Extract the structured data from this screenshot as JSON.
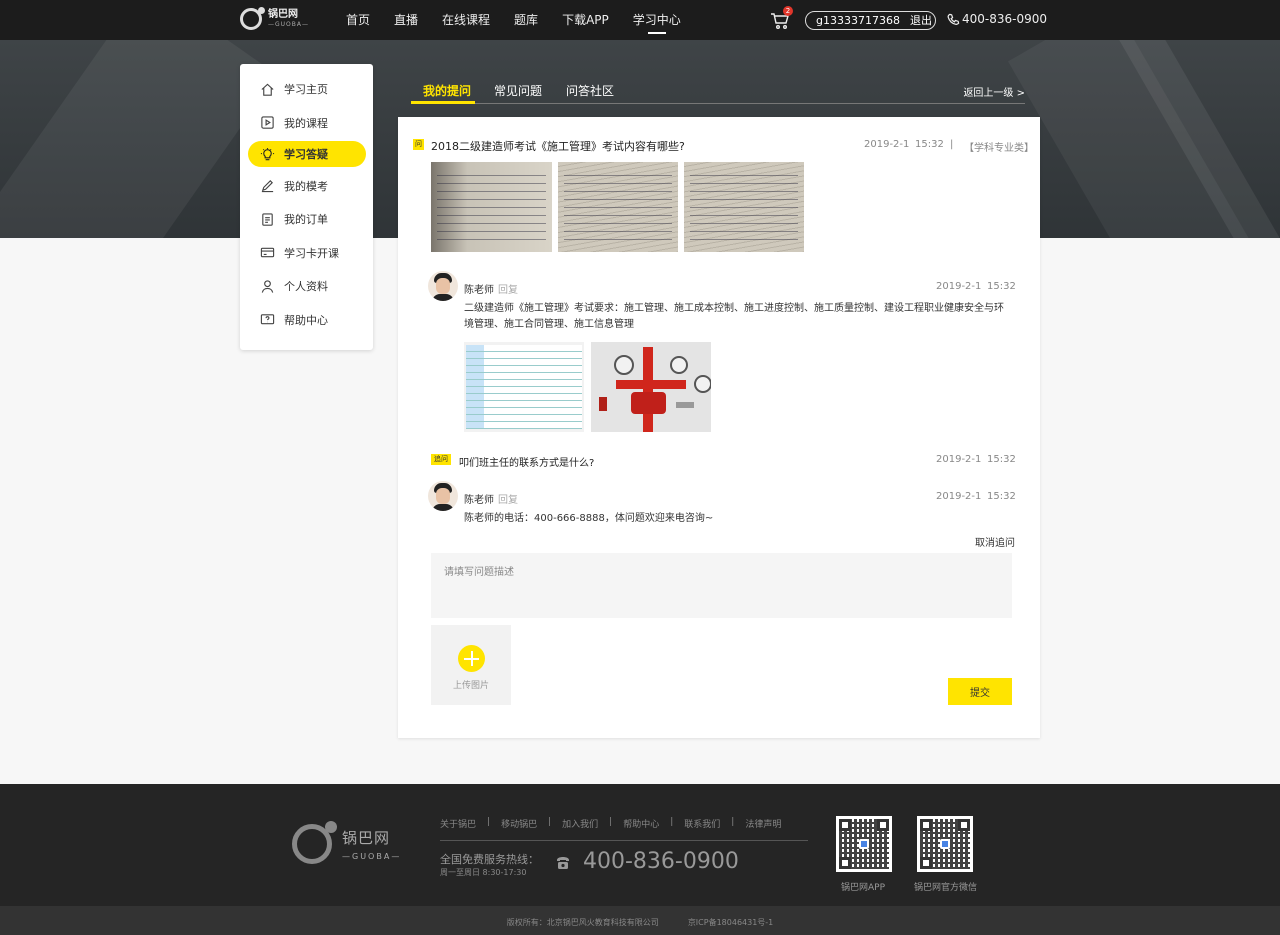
{
  "header": {
    "logo_cn": "锅巴网",
    "logo_en": "—GUOBA—",
    "nav": [
      "首页",
      "直播",
      "在线课程",
      "题库",
      "下载APP",
      "学习中心"
    ],
    "cart_count": "2",
    "username": "g13333717368",
    "logout": "退出",
    "hotline": "400-836-0900"
  },
  "sidebar": {
    "items": [
      {
        "label": "学习主页",
        "icon": "home-icon"
      },
      {
        "label": "我的课程",
        "icon": "play-icon"
      },
      {
        "label": "学习答疑",
        "icon": "lightbulb-icon"
      },
      {
        "label": "我的模考",
        "icon": "pen-icon"
      },
      {
        "label": "我的订单",
        "icon": "order-icon"
      },
      {
        "label": "学习卡开课",
        "icon": "card-icon"
      },
      {
        "label": "个人资料",
        "icon": "user-icon"
      },
      {
        "label": "帮助中心",
        "icon": "help-icon"
      }
    ]
  },
  "tabs": {
    "items": [
      "我的提问",
      "常见问题",
      "问答社区"
    ],
    "back": "返回上一级 >"
  },
  "question": {
    "badge": "问",
    "title": "2018二级建造师考试《施工管理》考试内容有哪些?",
    "date": "2019-2-1",
    "time": "15:32",
    "separator": "|",
    "category": "【学科专业类】"
  },
  "answer1": {
    "teacher": "陈老师",
    "reply_label": "回复",
    "date": "2019-2-1",
    "time": "15:32",
    "text": "二级建造师《施工管理》考试要求：施工管理、施工成本控制、施工进度控制、施工质量控制、建设工程职业健康安全与环境管理、施工合同管理、施工信息管理"
  },
  "followup": {
    "badge": "追问",
    "title": "叩们班主任的联系方式是什么?",
    "date": "2019-2-1",
    "time": "15:32"
  },
  "answer2": {
    "teacher": "陈老师",
    "reply_label": "回复",
    "date": "2019-2-1",
    "time": "15:32",
    "text": "陈老师的电话：400-666-8888，体问题欢迎来电咨询~"
  },
  "form": {
    "cancel": "取消追问",
    "placeholder": "请填写问题描述",
    "upload_label": "上传图片",
    "submit": "提交"
  },
  "footer": {
    "logo_cn": "锅巴网",
    "logo_en": "—GUOBA—",
    "links": [
      "关于锅巴",
      "移动锅巴",
      "加入我们",
      "帮助中心",
      "联系我们",
      "法律声明"
    ],
    "link_separator": "|",
    "hotline_label": "全国免费服务热线：",
    "hours": "周一至周日 8:30-17:30",
    "phone": "400-836-0900",
    "qr1_label": "锅巴网APP",
    "qr2_label": "锅巴网官方微信",
    "copyright": "版权所有：北京锅巴风火教育科技有限公司",
    "icp": "京ICP备18046431号-1"
  }
}
